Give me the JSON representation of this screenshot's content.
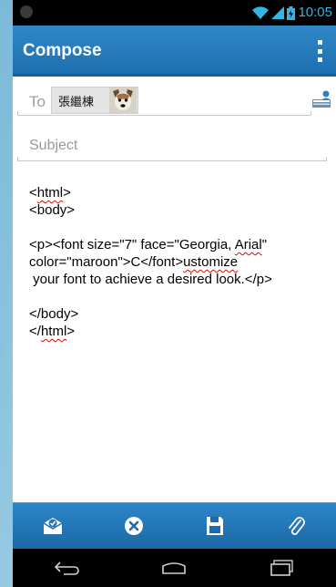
{
  "status_bar": {
    "time": "10:05",
    "icons": [
      "wifi-icon",
      "signal-icon",
      "battery-icon"
    ]
  },
  "action_bar": {
    "title": "Compose",
    "overflow_icon": "overflow-menu-icon"
  },
  "compose": {
    "to_label": "To",
    "recipient_name": "張繼棟",
    "add_recipient_icon": "add-contact-icon",
    "subject_placeholder": "Subject",
    "body_lines": [
      {
        "segments": [
          {
            "text": "<"
          },
          {
            "text": "html",
            "spell": true
          },
          {
            "text": ">"
          }
        ]
      },
      {
        "segments": [
          {
            "text": "<body>"
          }
        ]
      },
      {
        "segments": [
          {
            "text": ""
          }
        ]
      },
      {
        "segments": [
          {
            "text": "<p><font size=\"7\" face=\"Georgia, "
          },
          {
            "text": "Arial",
            "spell": true
          },
          {
            "text": "\""
          }
        ]
      },
      {
        "segments": [
          {
            "text": "color=\"maroon\">C</font>"
          },
          {
            "text": "ustomize",
            "spell": true
          }
        ]
      },
      {
        "segments": [
          {
            "text": " your font to achieve a desired look.</p>"
          }
        ]
      },
      {
        "segments": [
          {
            "text": ""
          }
        ]
      },
      {
        "segments": [
          {
            "text": "</body>"
          }
        ]
      },
      {
        "segments": [
          {
            "text": "</"
          },
          {
            "text": "html",
            "spell": true
          },
          {
            "text": ">"
          }
        ]
      }
    ]
  },
  "bottom_actions": [
    "send-icon",
    "discard-icon",
    "save-icon",
    "attach-icon"
  ],
  "nav_bar": [
    "back-icon",
    "home-icon",
    "recent-apps-icon"
  ],
  "colors": {
    "action_bar": "#1e6fae",
    "accent": "#33b5e5",
    "spell_underline": "#d01010"
  }
}
